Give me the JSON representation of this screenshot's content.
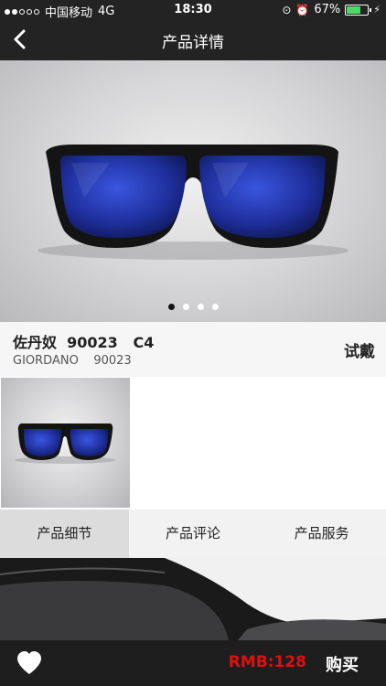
{
  "status_bar": {
    "carrier": "中国移动",
    "network": "4G",
    "time": "18:30",
    "battery": "67%",
    "battery_level": 0.67
  },
  "nav": {
    "title": "产品详情",
    "back_icon": "chevron-left-icon"
  },
  "gallery": {
    "page_count": 4,
    "active_index": 0
  },
  "product": {
    "name": "佐丹奴  90023   C4",
    "brand_line": "GIORDANO    90023",
    "try_on_label": "试戴"
  },
  "tabs": [
    {
      "label": "产品细节",
      "active": true
    },
    {
      "label": "产品评论",
      "active": false
    },
    {
      "label": "产品服务",
      "active": false
    }
  ],
  "bottom_bar": {
    "favorite_icon": "heart-icon",
    "price": "RMB:128",
    "buy_label": "购买"
  },
  "colors": {
    "header_bg": "#232323",
    "price_red": "#e01010",
    "lens_blue": "#2a3fc4"
  }
}
